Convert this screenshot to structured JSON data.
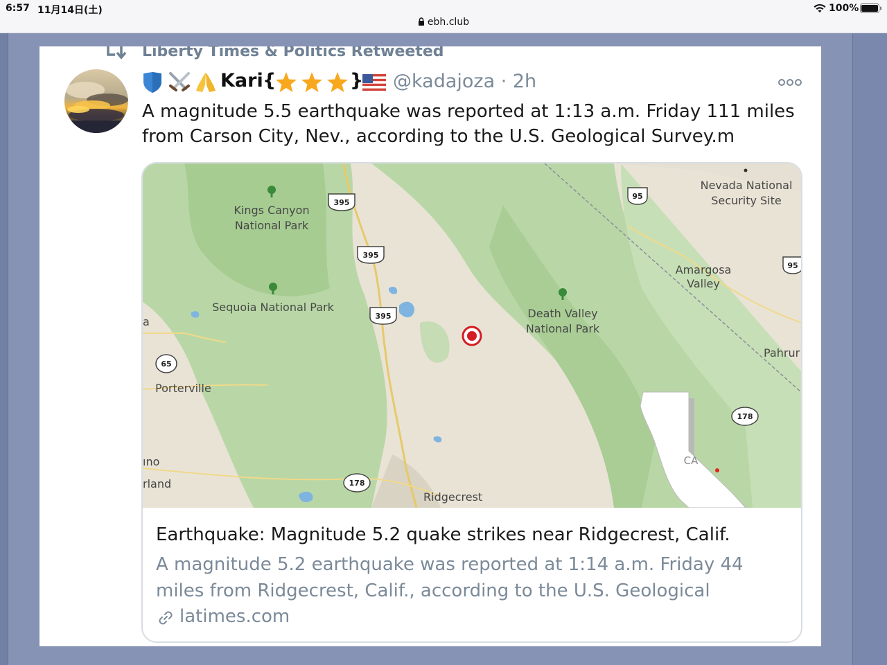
{
  "status_bar": {
    "time": "6:57",
    "date": "11月14日(土)",
    "url": "ebh.club",
    "battery": "100%"
  },
  "tweet": {
    "retweeted_by": "Liberty Times & Politics Retweeted",
    "author": {
      "name": "Kari",
      "brace_open": "{",
      "brace_close": "}",
      "handle": "@kadajoza · 2h"
    },
    "text": "A magnitude 5.5 earthquake was reported at 1:13 a.m. Friday 111 miles from Carson City, Nev., according to the U.S. Geological Survey.m",
    "card": {
      "title": "Earthquake: Magnitude 5.2 quake strikes near Ridgecrest, Calif.",
      "description": "A magnitude 5.2 earthquake was reported at 1:14 a.m. Friday 44 miles from Ridgecrest, Calif., according to the U.S. Geological",
      "domain": "latimes.com"
    }
  },
  "map": {
    "labels": {
      "kings_canyon_1": "Kings Canyon",
      "kings_canyon_2": "National Park",
      "sequoia": "Sequoia National Park",
      "death_valley_1": "Death Valley",
      "death_valley_2": "National Park",
      "nevada_security_1": "Nevada National",
      "nevada_security_2": "Security Site",
      "amargosa_1": "Amargosa",
      "amargosa_2": "Valley",
      "pahrump": "Pahrur",
      "porterville": "Porterville",
      "ridgecrest": "Ridgecrest",
      "edge_a": "a",
      "edge_ino": "ıno",
      "edge_rland": "rland",
      "inset_state": "CA"
    },
    "shields": {
      "us395_1": "395",
      "us395_2": "395",
      "us395_3": "395",
      "us95_1": "95",
      "us95_2": "95",
      "sr65": "65",
      "sr178_1": "178",
      "sr178_2": "178"
    }
  }
}
